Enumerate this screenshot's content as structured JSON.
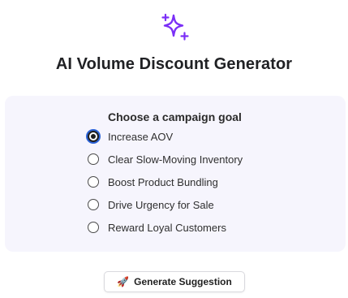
{
  "header": {
    "icon": "sparkles-icon",
    "title": "AI Volume Discount Generator",
    "accent_color": "#7b2ff7"
  },
  "goal_panel": {
    "title": "Choose a campaign goal",
    "options": [
      {
        "label": "Increase AOV",
        "selected": true
      },
      {
        "label": "Clear Slow-Moving Inventory",
        "selected": false
      },
      {
        "label": "Boost Product Bundling",
        "selected": false
      },
      {
        "label": "Drive Urgency for Sale",
        "selected": false
      },
      {
        "label": "Reward Loyal Customers",
        "selected": false
      }
    ]
  },
  "actions": {
    "generate_icon": "rocket-icon",
    "generate_label": "Generate Suggestion"
  }
}
